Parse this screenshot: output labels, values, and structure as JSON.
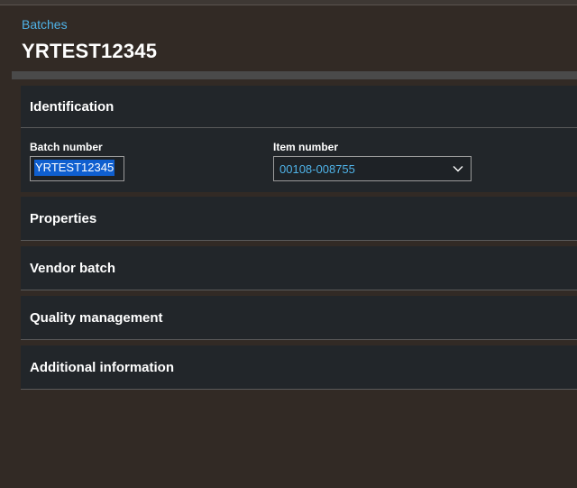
{
  "breadcrumb": "Batches",
  "page_title": "YRTEST12345",
  "sections": {
    "identification": {
      "title": "Identification",
      "batch_number_label": "Batch number",
      "batch_number_value": "YRTEST12345",
      "item_number_label": "Item number",
      "item_number_value": "00108-008755"
    },
    "properties": {
      "title": "Properties"
    },
    "vendor_batch": {
      "title": "Vendor batch"
    },
    "quality_management": {
      "title": "Quality management"
    },
    "additional_information": {
      "title": "Additional information"
    }
  },
  "icons": {
    "dropdown": "chevron-down-icon"
  },
  "colors": {
    "background": "#322a25",
    "panel": "#22262a",
    "link": "#4fb3e8",
    "selection": "#0f5fcf"
  }
}
